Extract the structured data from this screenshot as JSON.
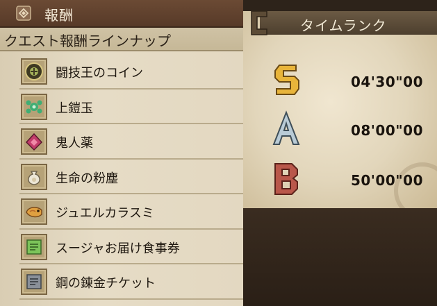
{
  "left_panel": {
    "header_title": "報酬",
    "subheader": "クエスト報酬ラインナップ",
    "rewards": [
      {
        "name": "闘技王のコイン",
        "icon": "coin-icon"
      },
      {
        "name": "上鎧玉",
        "icon": "armor-sphere-icon"
      },
      {
        "name": "鬼人薬",
        "icon": "potion-icon"
      },
      {
        "name": "生命の粉塵",
        "icon": "dust-bag-icon"
      },
      {
        "name": "ジュエルカラスミ",
        "icon": "fish-roe-icon"
      },
      {
        "name": "スージャお届け食事券",
        "icon": "meal-ticket-icon"
      },
      {
        "name": "鋼の錬金チケット",
        "icon": "melding-ticket-icon"
      }
    ]
  },
  "right_panel": {
    "title": "タイムランク",
    "ranks": [
      {
        "rank": "S",
        "time": "04'30\"00",
        "color": "#e8b43a"
      },
      {
        "rank": "A",
        "time": "08'00\"00",
        "color": "#b9cbd6"
      },
      {
        "rank": "B",
        "time": "50'00\"00",
        "color": "#b9574a"
      }
    ]
  }
}
